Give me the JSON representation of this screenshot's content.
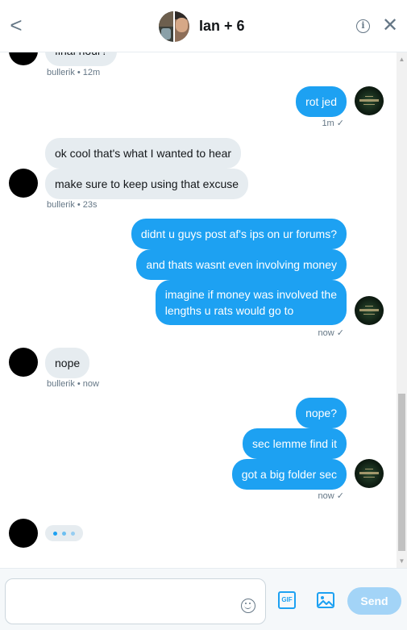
{
  "header": {
    "back_glyph": "<",
    "title": "Ian + 6",
    "info_glyph": "i",
    "close_glyph": "✕"
  },
  "messages": [
    {
      "direction": "in",
      "text": "final hour?",
      "meta": "bullerik • 12m"
    },
    {
      "direction": "out",
      "text": "rot jed",
      "meta": "1m ✓"
    },
    {
      "direction": "in",
      "text": "ok cool that's what I wanted to hear"
    },
    {
      "direction": "in",
      "text": "make sure to keep using that excuse",
      "meta": "bullerik • 23s"
    },
    {
      "direction": "out",
      "text": "didnt u guys post af's ips on ur forums?"
    },
    {
      "direction": "out",
      "text": "and thats wasnt even involving money"
    },
    {
      "direction": "out",
      "text_line1": "imagine if money was involved the",
      "text_line2": "lengths u rats would go to",
      "meta": "now ✓"
    },
    {
      "direction": "in",
      "text": "nope",
      "meta": "bullerik • now"
    },
    {
      "direction": "out",
      "text": "nope?"
    },
    {
      "direction": "out",
      "text": "sec lemme find it"
    },
    {
      "direction": "out",
      "text": "got a big folder sec",
      "meta": "now ✓"
    }
  ],
  "composer": {
    "input_value": "",
    "gif_label": "GIF",
    "send_label": "Send",
    "emoji_icon": "emoji-icon",
    "image_icon": "image-icon"
  },
  "colors": {
    "accent": "#1da1f2",
    "incoming_bubble": "#e6ecf0",
    "send_disabled": "#a3d4f7",
    "meta_text": "#657786"
  }
}
